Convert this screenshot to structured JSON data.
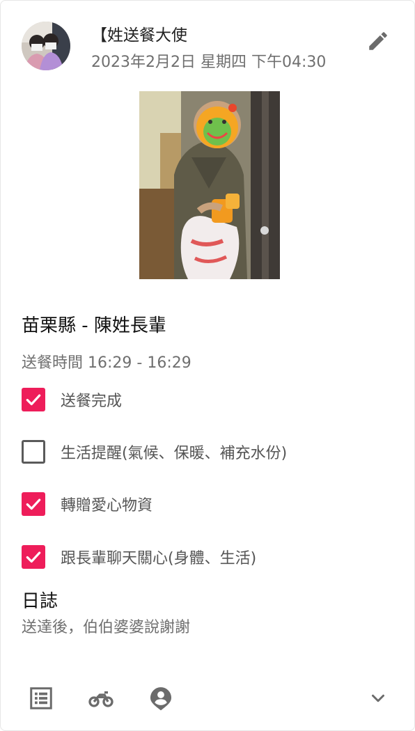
{
  "header": {
    "author": "【姓送餐大使",
    "datetime": "2023年2月2日 星期四 下午04:30",
    "avatar_icon": "user-avatar-photo",
    "edit_icon": "pencil-icon"
  },
  "photo": {
    "description_icon": "delivery-photo"
  },
  "recipient": "苗栗縣 - 陳姓長輩",
  "time_range": "送餐時間 16:29 - 16:29",
  "tasks": [
    {
      "label": "送餐完成",
      "checked": true
    },
    {
      "label": "生活提醒(氣候、保暖、補充水份)",
      "checked": false
    },
    {
      "label": "轉贈愛心物資",
      "checked": true
    },
    {
      "label": "跟長輩聊天關心(身體、生活)",
      "checked": true
    }
  ],
  "log": {
    "title": "日誌",
    "text": "送達後，伯伯婆婆說謝謝"
  },
  "bottom_bar": {
    "icons": [
      "list-icon",
      "motorcycle-icon",
      "user-location-icon",
      "chevron-down-icon"
    ]
  },
  "colors": {
    "accent": "#ee1d5a",
    "icon_gray": "#6b6b6b",
    "secondary_text": "#6f6f6f"
  }
}
